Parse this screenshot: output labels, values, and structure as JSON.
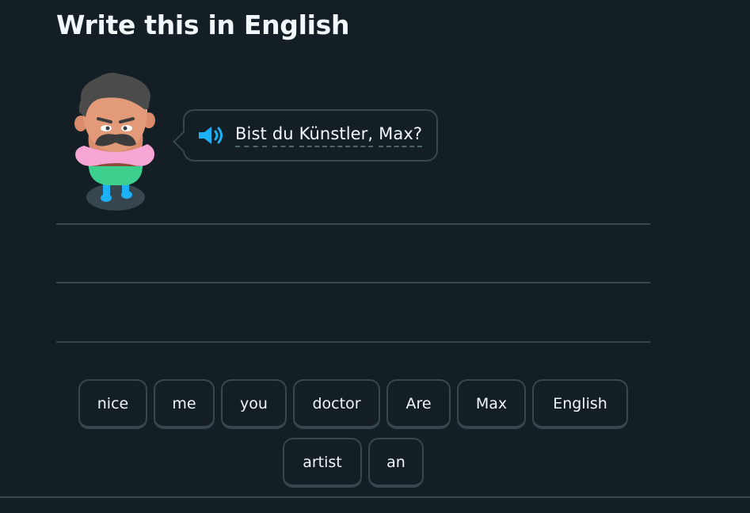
{
  "header": {
    "title": "Write this in English"
  },
  "prompt": {
    "sentence": "Bist du Künstler, Max?",
    "words": [
      "Bist",
      "du",
      "Künstler,",
      "Max?"
    ],
    "speaker_icon": "speaker-icon"
  },
  "character": {
    "icon": "character-avatar"
  },
  "word_bank": {
    "tiles": [
      {
        "label": "nice"
      },
      {
        "label": "me"
      },
      {
        "label": "you"
      },
      {
        "label": "doctor"
      },
      {
        "label": "Are"
      },
      {
        "label": "Max"
      },
      {
        "label": "English"
      },
      {
        "label": "artist"
      },
      {
        "label": "an"
      }
    ]
  },
  "colors": {
    "background": "#131f24",
    "border": "#37464f",
    "text": "#f1f7fb",
    "speaker": "#1cb0f6"
  }
}
